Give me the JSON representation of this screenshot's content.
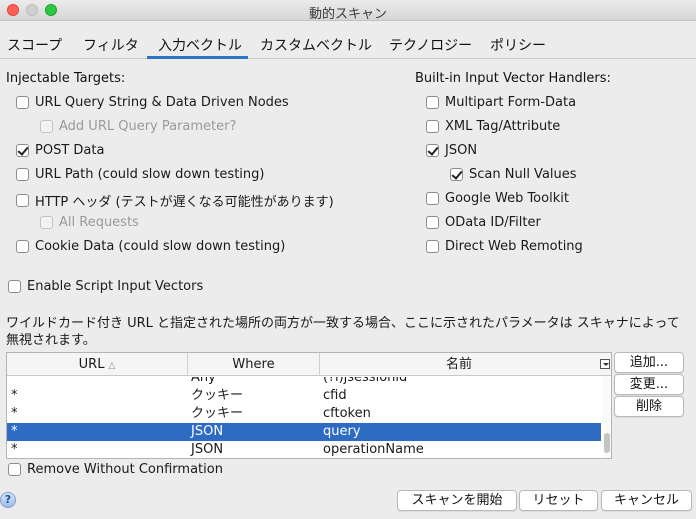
{
  "window": {
    "title": "動的スキャン"
  },
  "tabs": [
    {
      "label": "スコープ"
    },
    {
      "label": "フィルタ"
    },
    {
      "label": "入力ベクトル"
    },
    {
      "label": "カスタムベクトル"
    },
    {
      "label": "テクノロジー"
    },
    {
      "label": "ポリシー"
    }
  ],
  "injectable": {
    "heading": "Injectable Targets:",
    "items": [
      {
        "label": "URL Query String & Data Driven Nodes",
        "checked": false,
        "disabled": false
      },
      {
        "label": "Add URL Query Parameter?",
        "checked": false,
        "disabled": true
      },
      {
        "label": "POST Data",
        "checked": true,
        "disabled": false
      },
      {
        "label": "URL Path (could slow down testing)",
        "checked": false,
        "disabled": false
      },
      {
        "label": "HTTP ヘッダ (テストが遅くなる可能性があります)",
        "checked": false,
        "disabled": false
      },
      {
        "label": "All Requests",
        "checked": false,
        "disabled": true
      },
      {
        "label": "Cookie Data (could slow down testing)",
        "checked": false,
        "disabled": false
      }
    ]
  },
  "handlers": {
    "heading": "Built-in Input Vector Handlers:",
    "items": [
      {
        "label": "Multipart Form-Data",
        "checked": false
      },
      {
        "label": "XML Tag/Attribute",
        "checked": false
      },
      {
        "label": "JSON",
        "checked": true
      },
      {
        "label": "Scan Null Values",
        "checked": true
      },
      {
        "label": "Google Web Toolkit",
        "checked": false
      },
      {
        "label": "OData ID/Filter",
        "checked": false
      },
      {
        "label": "Direct Web Remoting",
        "checked": false
      }
    ]
  },
  "script_vectors": {
    "label": "Enable Script Input Vectors",
    "checked": false
  },
  "description": "ワイルドカード付き URL と指定された場所の両方が一致する場合、ここに示されたパラメータは スキャナによって無視されます。",
  "table": {
    "columns": {
      "url": "URL",
      "where": "Where",
      "name": "名前"
    },
    "rows": [
      {
        "url": "",
        "where": "Any",
        "name": "(?i)jsessionid"
      },
      {
        "url": "*",
        "where": "クッキー",
        "name": "cfid"
      },
      {
        "url": "*",
        "where": "クッキー",
        "name": "cftoken"
      },
      {
        "url": "*",
        "where": "JSON",
        "name": "query"
      },
      {
        "url": "*",
        "where": "JSON",
        "name": "operationName"
      }
    ],
    "selected_row": 3,
    "scroll_position": 1.0
  },
  "side_buttons": {
    "add": "追加...",
    "modify": "変更...",
    "remove": "削除"
  },
  "remove_confirm": {
    "label": "Remove Without Confirmation",
    "checked": false
  },
  "footer": {
    "help": "?",
    "start": "スキャンを開始",
    "reset": "リセット",
    "cancel": "キャンセル"
  },
  "colors": {
    "accent": "#2d74c4",
    "selection": "#2e6cc4"
  }
}
